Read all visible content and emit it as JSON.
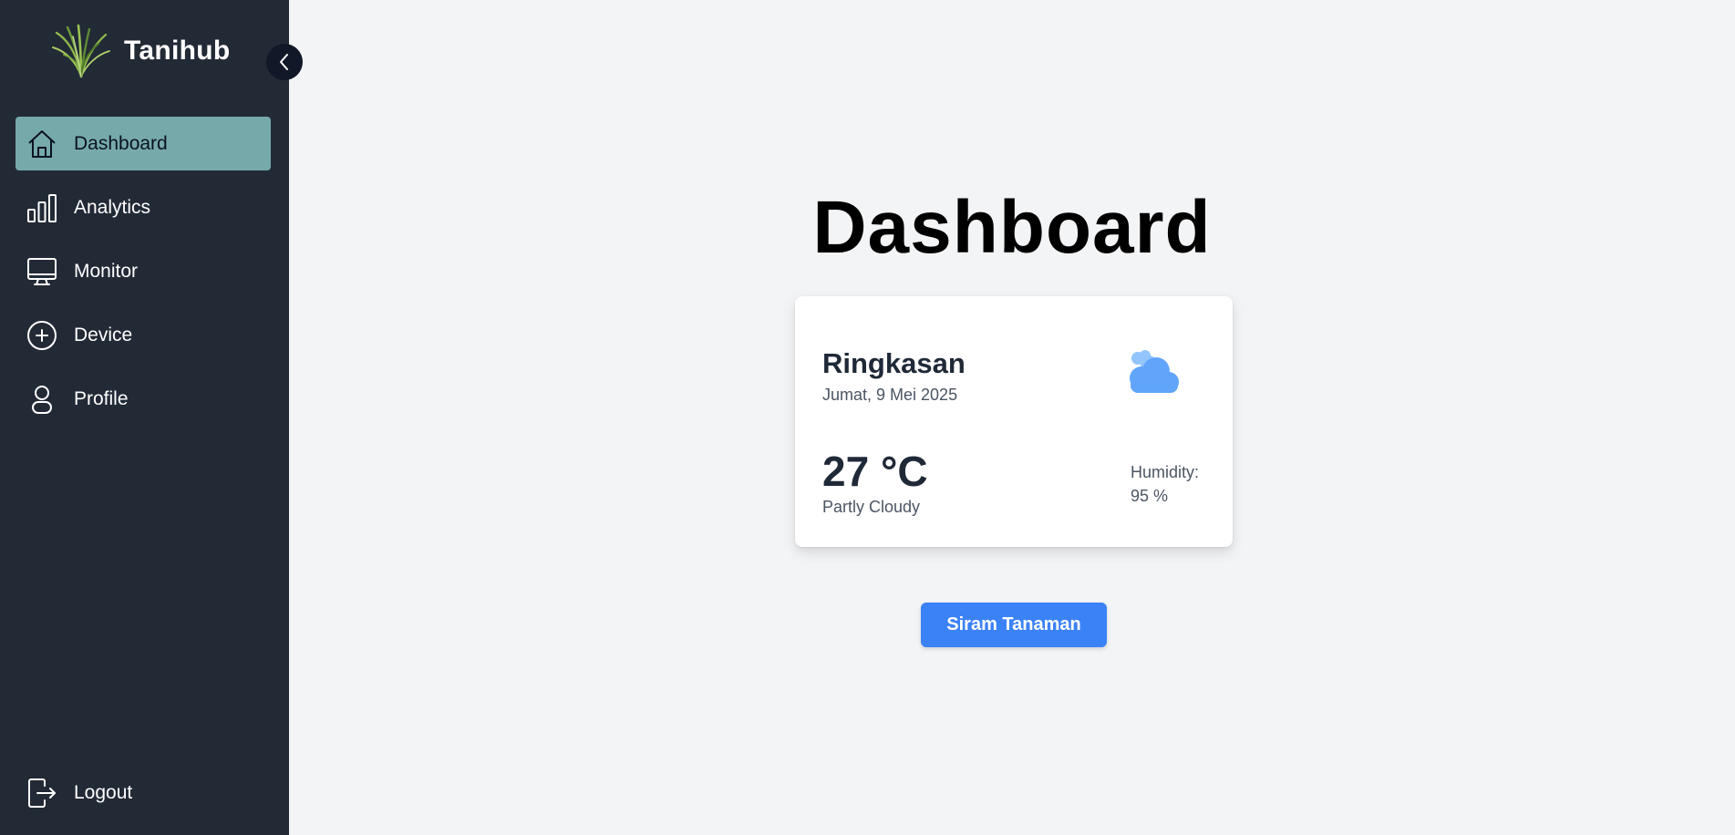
{
  "app": {
    "name": "Tanihub",
    "logo_icon": "grass-logo-icon"
  },
  "sidebar": {
    "collapse_icon": "chevron-left-icon",
    "items": [
      {
        "label": "Dashboard",
        "icon": "home-icon",
        "active": true
      },
      {
        "label": "Analytics",
        "icon": "bar-chart-icon",
        "active": false
      },
      {
        "label": "Monitor",
        "icon": "monitor-icon",
        "active": false
      },
      {
        "label": "Device",
        "icon": "plus-circle-icon",
        "active": false
      },
      {
        "label": "Profile",
        "icon": "user-icon",
        "active": false
      }
    ],
    "logout": {
      "label": "Logout",
      "icon": "logout-icon"
    }
  },
  "main": {
    "title": "Dashboard",
    "weather_card": {
      "title": "Ringkasan",
      "date": "Jumat, 9 Mei 2025",
      "icon": "cloud-icon",
      "temperature": "27 °C",
      "condition": "Partly Cloudy",
      "humidity_label": "Humidity:",
      "humidity_value": "95 %"
    },
    "action_button": "Siram Tanaman"
  },
  "colors": {
    "sidebar_bg": "#222a36",
    "active_item_bg": "#76aaaa",
    "page_bg": "#f3f4f6",
    "primary_button": "#3b82f6",
    "cloud": "#60a5fa"
  }
}
